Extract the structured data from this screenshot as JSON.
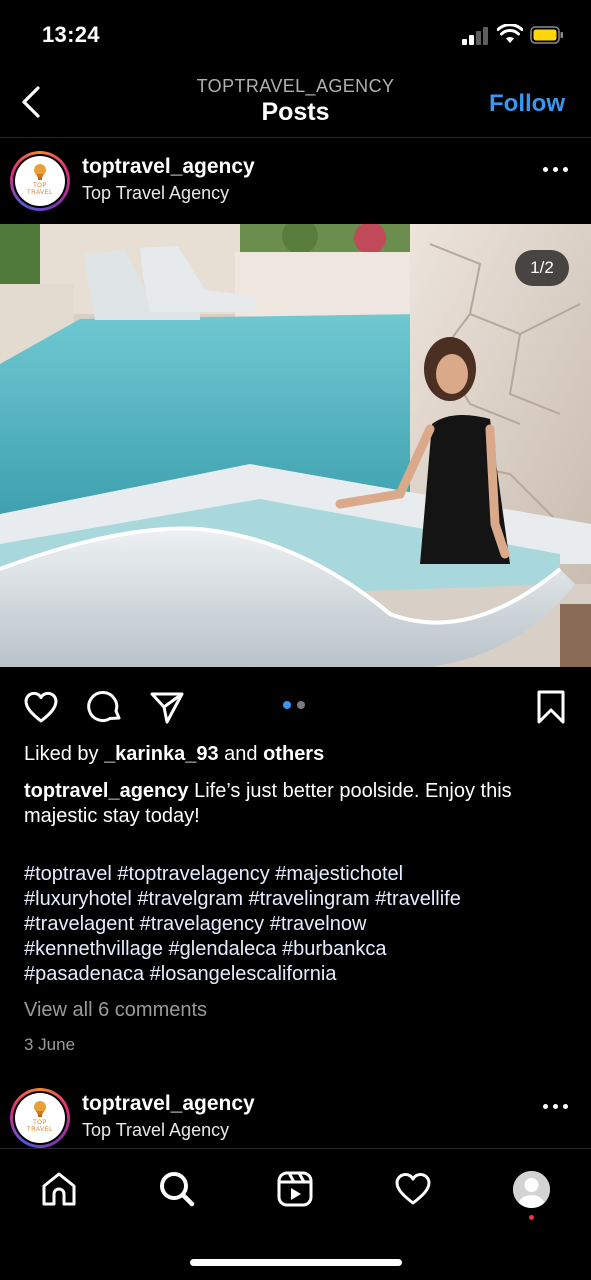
{
  "status_bar": {
    "time": "13:24"
  },
  "header": {
    "subtitle": "TOPTRAVEL_AGENCY",
    "title": "Posts",
    "follow_label": "Follow"
  },
  "post": {
    "username": "toptravel_agency",
    "display_name": "Top Travel Agency",
    "avatar_text": [
      "TOP",
      "TRAVEL"
    ],
    "image_counter": "1/2",
    "liked_by_prefix": "Liked by ",
    "liked_by_user": "_karinka_93",
    "liked_by_middle": " and ",
    "liked_by_others": "others",
    "caption_user": "toptravel_agency",
    "caption_text": " Life’s just better poolside. Enjoy this majestic stay today!",
    "hashtag_lines": [
      "#toptravel #toptravelagency #majestichotel",
      "#luxuryhotel #travelgram #travelingram #travellife",
      "#travelagent #travelagency #travelnow",
      "#kennethvillage #glendaleca #burbankca",
      "#pasadenaca #losangelescalifornia"
    ],
    "view_comments": "View all 6 comments",
    "date": "3 June",
    "carousel": {
      "current": 1,
      "total": 2
    }
  },
  "next_post": {
    "username": "toptravel_agency",
    "display_name": "Top Travel Agency",
    "avatar_text": [
      "TOP",
      "TRAVEL"
    ]
  },
  "colors": {
    "background": "#000000",
    "accent_blue": "#3897f0",
    "secondary_text": "#9a9a9a",
    "notification_red": "#ff2d3d"
  },
  "tabbar": {
    "icons": [
      "home-icon",
      "search-icon",
      "reels-icon",
      "activity-heart-icon",
      "profile-avatar"
    ]
  }
}
